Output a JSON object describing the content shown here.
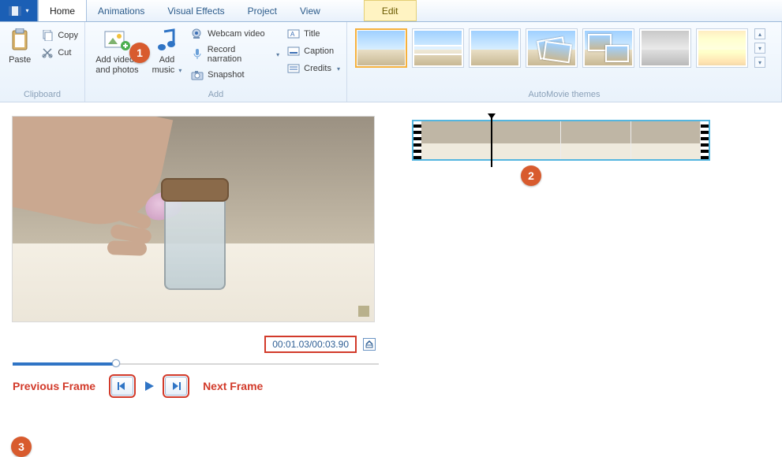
{
  "tabs": {
    "home": "Home",
    "animations": "Animations",
    "visual_effects": "Visual Effects",
    "project": "Project",
    "view": "View",
    "edit": "Edit"
  },
  "ribbon": {
    "clipboard": {
      "paste": "Paste",
      "copy": "Copy",
      "cut": "Cut",
      "group_label": "Clipboard"
    },
    "add": {
      "add_videos": "Add videos\nand photos",
      "add_music": "Add\nmusic",
      "webcam": "Webcam video",
      "record_narration": "Record narration",
      "snapshot": "Snapshot",
      "title": "Title",
      "caption": "Caption",
      "credits": "Credits",
      "group_label": "Add"
    },
    "automovie": {
      "group_label": "AutoMovie themes"
    }
  },
  "preview": {
    "timecode": "00:01.03/00:03.90"
  },
  "annotations": {
    "prev_frame": "Previous Frame",
    "next_frame": "Next Frame",
    "n1": "1",
    "n2": "2",
    "n3": "3"
  }
}
